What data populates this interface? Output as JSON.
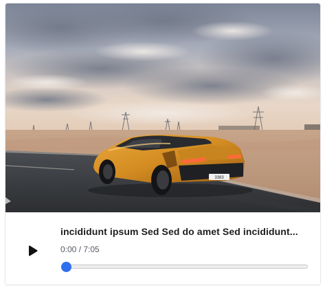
{
  "media": {
    "title": "incididunt ipsum Sed Sed do amet Sed incididunt...",
    "time_display": "0:00 / 7:05",
    "progress": 0.0,
    "thumbnail_subject": "orange sports car on desert road at dusk",
    "plate_text": "3383"
  },
  "icons": {
    "play": "play-icon"
  },
  "colors": {
    "accent": "#2f6fed",
    "title_text": "#1d1d1f",
    "time_text": "#555a63",
    "track": "#eeeeee"
  }
}
